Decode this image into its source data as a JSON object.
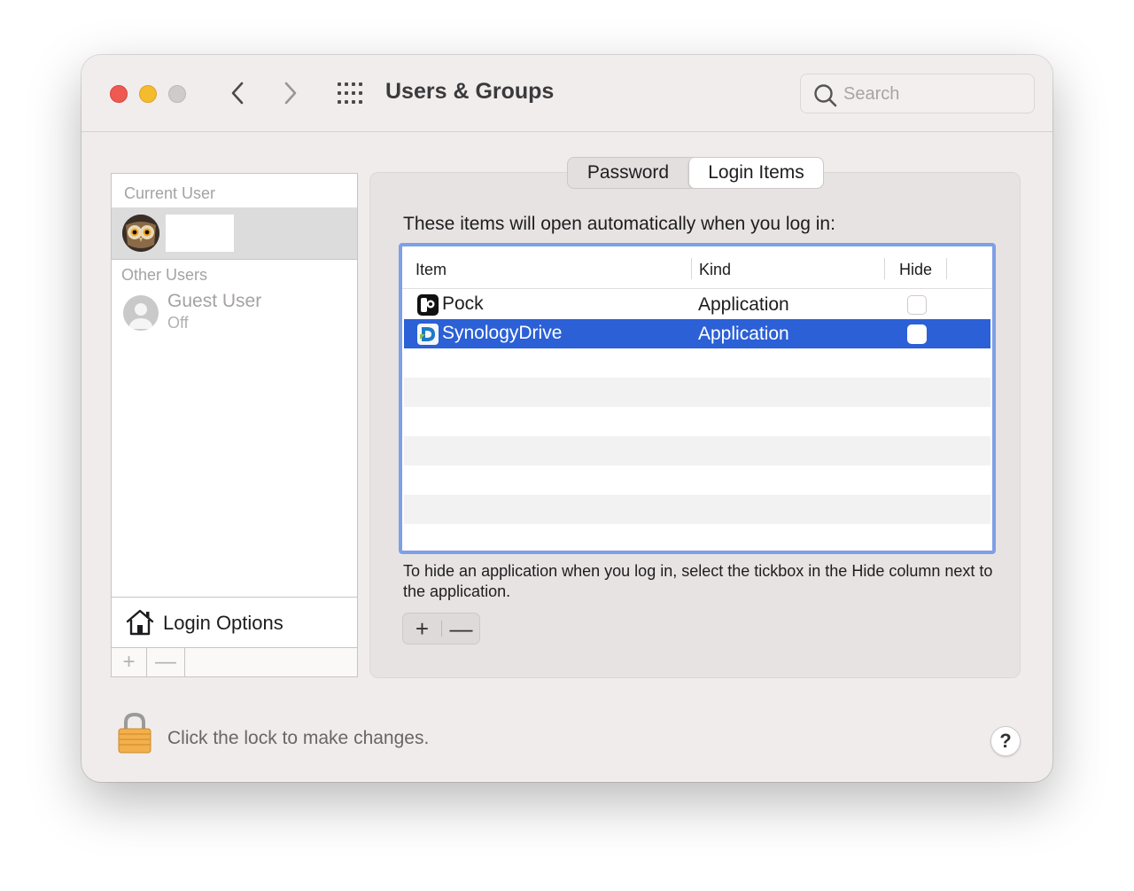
{
  "window": {
    "title": "Users & Groups",
    "search_placeholder": "Search"
  },
  "sidebar": {
    "current_user_label": "Current User",
    "other_users_label": "Other Users",
    "guest": {
      "name": "Guest User",
      "status": "Off"
    },
    "login_options_label": "Login Options",
    "add_label": "+",
    "remove_label": "—"
  },
  "tabs": [
    {
      "label": "Password",
      "selected": false
    },
    {
      "label": "Login Items",
      "selected": true
    }
  ],
  "login_items": {
    "intro": "These items will open automatically when you log in:",
    "columns": [
      "Item",
      "Kind",
      "Hide"
    ],
    "rows": [
      {
        "item": "Pock",
        "kind": "Application",
        "hide": false,
        "selected": false,
        "icon": "pock-app-icon"
      },
      {
        "item": "SynologyDrive",
        "kind": "Application",
        "hide": false,
        "selected": true,
        "icon": "synology-drive-app-icon"
      }
    ],
    "hint": "To hide an application when you log in, select the tickbox in the Hide column next to the application.",
    "add_label": "+",
    "remove_label": "—"
  },
  "footer": {
    "lock_text": "Click the lock to make changes.",
    "help_label": "?"
  },
  "colors": {
    "selection": "#2b60d6",
    "focus_ring": "#7f9fe6",
    "close": "#ee5a52",
    "minimize": "#f4bb2f"
  }
}
